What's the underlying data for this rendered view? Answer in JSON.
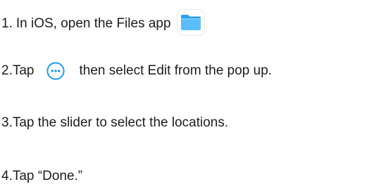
{
  "steps": [
    {
      "number": "1.",
      "text": "In iOS, open the Files app",
      "icon": "files-app-icon"
    },
    {
      "number": "2.",
      "text_before": "Tap",
      "icon": "more-ellipsis-circle-icon",
      "text_after": "then select Edit from the pop up."
    },
    {
      "number": "3.",
      "text": "Tap the slider to select the locations."
    },
    {
      "number": "4.",
      "text": "Tap “Done.”"
    }
  ],
  "colors": {
    "text": "#1c1c1e",
    "accent_blue": "#1a9bf0",
    "folder_light": "#5cc0ff",
    "folder_dark": "#1596ec"
  }
}
